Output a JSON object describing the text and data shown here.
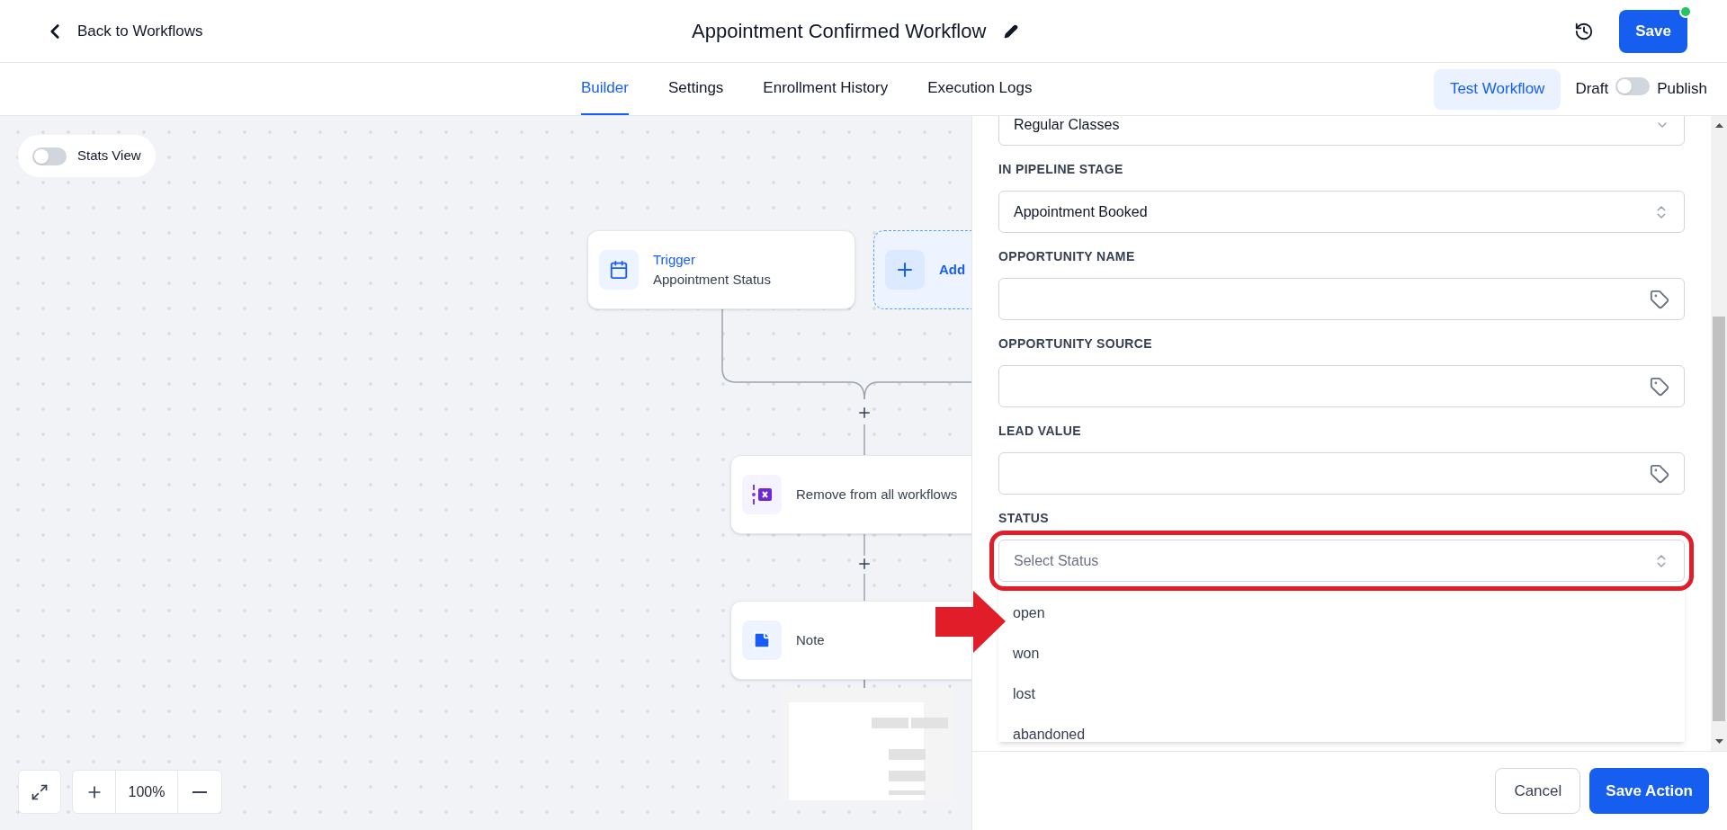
{
  "header": {
    "back_link": "Back to Workflows",
    "title": "Appointment Confirmed Workflow",
    "save_button": "Save"
  },
  "tabs": [
    {
      "label": "Builder",
      "selected": true
    },
    {
      "label": "Settings",
      "selected": false
    },
    {
      "label": "Enrollment History",
      "selected": false
    },
    {
      "label": "Execution Logs",
      "selected": false
    }
  ],
  "test_button": "Test Workflow",
  "publish_toggle": {
    "off_label": "Draft",
    "on_label": "Publish",
    "on": false
  },
  "canvas": {
    "stats_view": {
      "label": "Stats View",
      "on": false
    },
    "nodes": [
      {
        "kind": "trigger",
        "title": "Trigger",
        "subtitle": "Appointment Status"
      },
      {
        "kind": "add",
        "title": "Add"
      },
      {
        "kind": "remove",
        "title": "Remove from all workflows"
      },
      {
        "kind": "note",
        "title": "Note"
      }
    ],
    "zoom_level": "100%"
  },
  "panel": {
    "fields": [
      {
        "kind": "select",
        "value": "Regular Classes",
        "clipped": true
      },
      {
        "kind": "select",
        "label": "IN PIPELINE STAGE",
        "value": "Appointment Booked"
      },
      {
        "kind": "tag",
        "label": "OPPORTUNITY NAME"
      },
      {
        "kind": "tag",
        "label": "OPPORTUNITY SOURCE"
      },
      {
        "kind": "tag",
        "label": "LEAD VALUE"
      },
      {
        "kind": "select",
        "label": "STATUS",
        "placeholder": "Select Status",
        "highlighted": true,
        "expanded": true,
        "options": [
          "open",
          "won",
          "lost",
          "abandoned"
        ]
      }
    ],
    "buttons": [
      {
        "kind": "secondary",
        "label": "Cancel"
      },
      {
        "kind": "primary",
        "label": "Save Action"
      }
    ]
  }
}
